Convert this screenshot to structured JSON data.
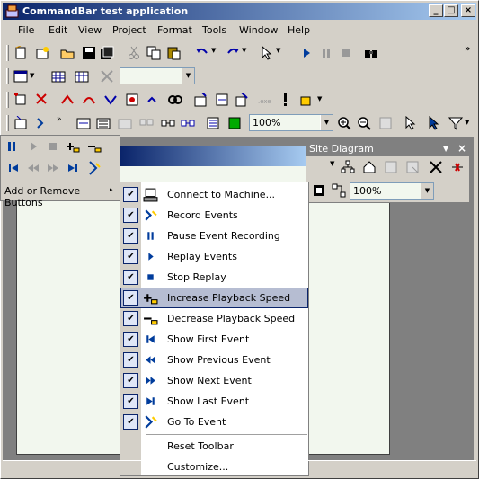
{
  "app": {
    "title": "CommandBar test application"
  },
  "menubar": [
    {
      "label": "File"
    },
    {
      "label": "Edit"
    },
    {
      "label": "View"
    },
    {
      "label": "Project"
    },
    {
      "label": "Format"
    },
    {
      "label": "Tools"
    },
    {
      "label": "Window"
    },
    {
      "label": "Help"
    }
  ],
  "toolbar4": {
    "zoom": "100%"
  },
  "float_toolbar": {
    "title": "Site Diagram",
    "zoom": "100%"
  },
  "popup": {
    "add_remove_label": "Add or Remove Buttons"
  },
  "context_menu": {
    "items": [
      {
        "label": "Connect to Machine...",
        "checked": true,
        "icon": "connect-icon"
      },
      {
        "label": "Record Events",
        "checked": true,
        "icon": "record-icon"
      },
      {
        "label": "Pause Event Recording",
        "checked": true,
        "icon": "pause-icon"
      },
      {
        "label": "Replay Events",
        "checked": true,
        "icon": "play-icon"
      },
      {
        "label": "Stop Replay",
        "checked": true,
        "icon": "stop-icon"
      },
      {
        "label": "Increase Playback Speed",
        "checked": true,
        "icon": "increase-speed-icon",
        "highlighted": true
      },
      {
        "label": "Decrease Playback Speed",
        "checked": true,
        "icon": "decrease-speed-icon"
      },
      {
        "label": "Show First Event",
        "checked": true,
        "icon": "first-icon"
      },
      {
        "label": "Show Previous Event",
        "checked": true,
        "icon": "previous-icon"
      },
      {
        "label": "Show Next Event",
        "checked": true,
        "icon": "next-icon"
      },
      {
        "label": "Show Last Event",
        "checked": true,
        "icon": "last-icon"
      },
      {
        "label": "Go To Event",
        "checked": true,
        "icon": "goto-icon"
      }
    ],
    "reset_label": "Reset Toolbar",
    "customize_label": "Customize..."
  },
  "colors": {
    "title_start": "#0a246a",
    "title_end": "#a6caf0",
    "highlight": "#b6bdd2",
    "face": "#d4d0c8"
  }
}
